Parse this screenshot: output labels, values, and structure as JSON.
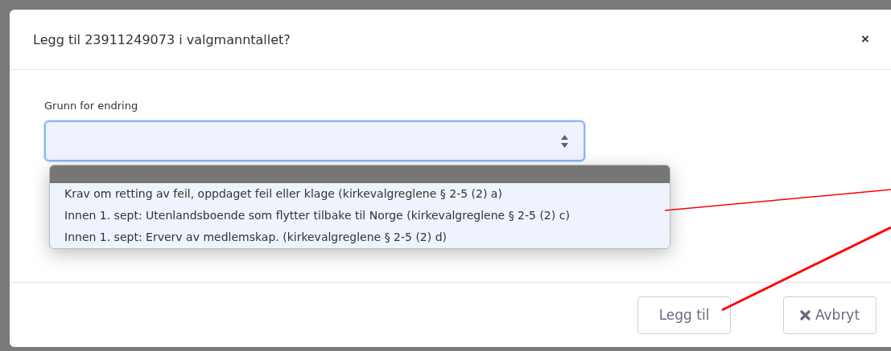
{
  "dialog": {
    "title": "Legg til 23911249073 i valgmanntallet?",
    "close": "×"
  },
  "field": {
    "label": "Grunn for endring",
    "expanded": true
  },
  "dropdown": {
    "blank_option_highlighted": true,
    "options": [
      {
        "text": "Krav om retting av feil, oppdaget feil eller klage (kirkevalgreglene § 2-5 (2) a)",
        "selected": false
      },
      {
        "text": "Innen 1. sept: Utenlandsboende som flytter tilbake til Norge (kirkevalgreglene § 2-5 (2) c)",
        "selected": false
      },
      {
        "text": "Innen 1. sept: Erverv av medlemskap. (kirkevalgreglene § 2-5 (2) d)",
        "selected": false
      }
    ]
  },
  "buttons": [
    {
      "kind": "primary",
      "label": "Legg til"
    },
    {
      "kind": "cancel",
      "label": "Avbryt"
    }
  ],
  "annotations": [
    {
      "kind": "thin-line"
    },
    {
      "kind": "thick-line"
    }
  ]
}
